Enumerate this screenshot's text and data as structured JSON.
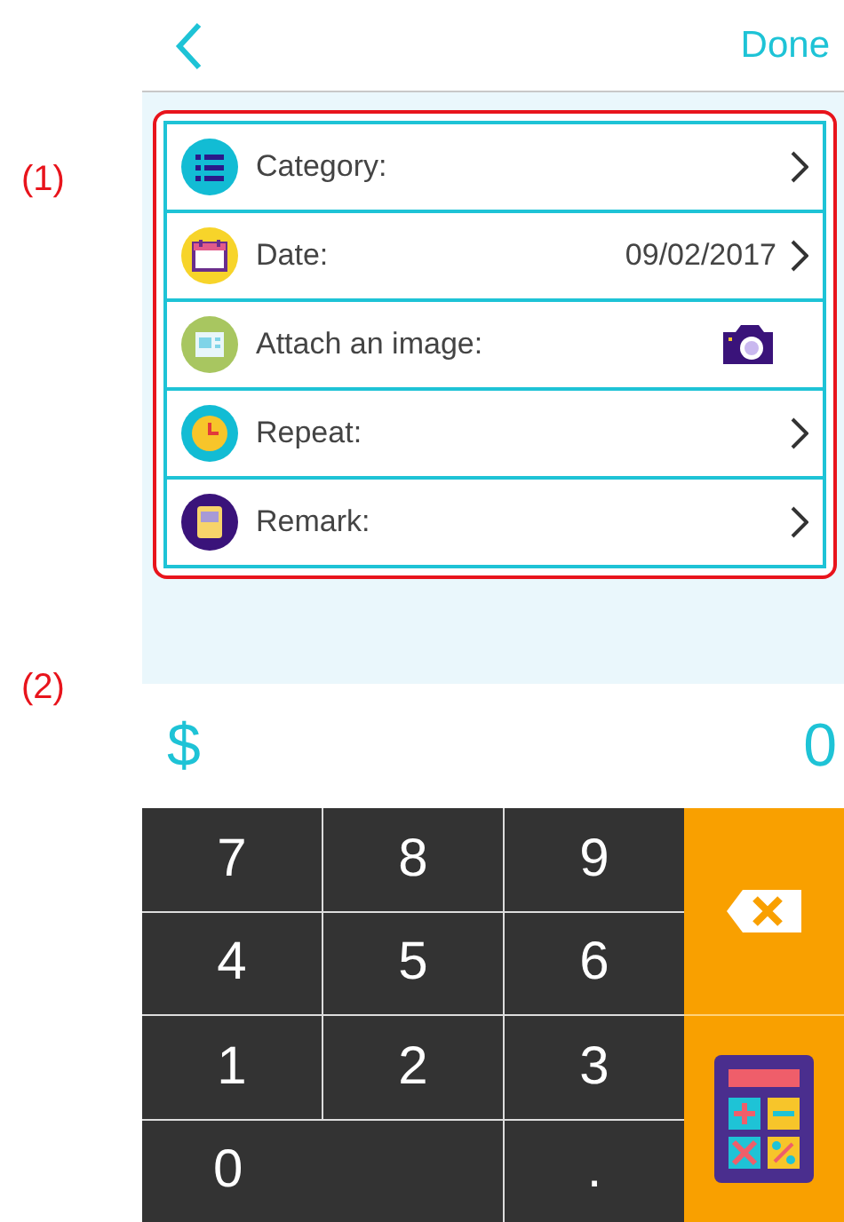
{
  "annotations": [
    "(1)",
    "(2)"
  ],
  "header": {
    "done": "Done"
  },
  "form_rows": [
    {
      "label": "Category:",
      "kind": "link"
    },
    {
      "label": "Date:",
      "value": "09/02/2017",
      "kind": "link"
    },
    {
      "label": "Attach an image:",
      "kind": "attachment"
    },
    {
      "label": "Repeat:",
      "kind": "link"
    },
    {
      "label": "Remark:",
      "kind": "link"
    }
  ],
  "amount": {
    "currency": "$",
    "value": "0"
  },
  "keypad": [
    {
      "label": "7",
      "kind": "digit"
    },
    {
      "label": "8",
      "kind": "digit"
    },
    {
      "label": "9",
      "kind": "digit"
    },
    {
      "label": "4",
      "kind": "digit"
    },
    {
      "label": "5",
      "kind": "digit"
    },
    {
      "label": "6",
      "kind": "digit"
    },
    {
      "label": "1",
      "kind": "digit"
    },
    {
      "label": "2",
      "kind": "digit"
    },
    {
      "label": "3",
      "kind": "digit"
    },
    {
      "label": "0",
      "kind": "wide"
    },
    {
      "label": ".",
      "kind": "digit"
    }
  ]
}
